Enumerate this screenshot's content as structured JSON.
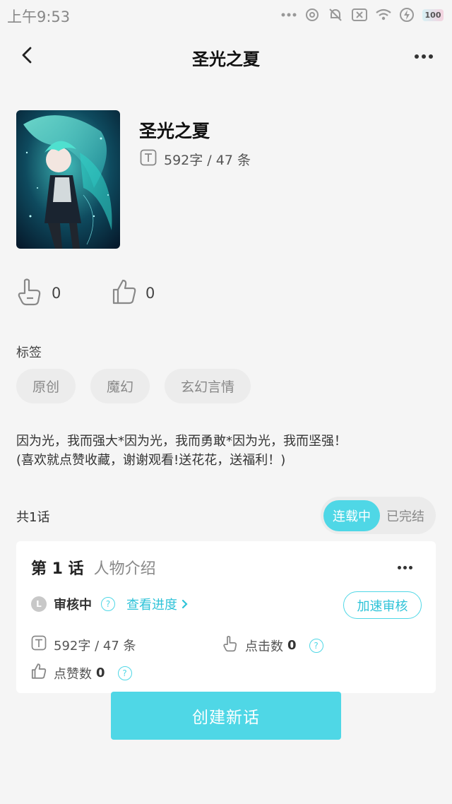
{
  "status_bar": {
    "time": "上午9:53",
    "battery": "100",
    "icons": [
      "dots-icon",
      "alarm-icon",
      "mute-icon",
      "sim-icon",
      "wifi-icon",
      "charging-icon",
      "battery-icon"
    ]
  },
  "navbar": {
    "title": "圣光之夏",
    "back_icon": "chevron-left-icon",
    "more_icon": "more-icon"
  },
  "book": {
    "title": "圣光之夏",
    "meta": "592字 / 47 条",
    "cover_icon": "anime-cover-image"
  },
  "reactions": [
    {
      "icon": "click-hand-icon",
      "count": "0"
    },
    {
      "icon": "thumbs-up-icon",
      "count": "0"
    }
  ],
  "tags": {
    "label": "标签",
    "items": [
      "原创",
      "魔幻",
      "玄幻言情"
    ]
  },
  "description": {
    "line1": "因为光，我而强大*因为光，我而勇敢*因为光，我而坚强！",
    "line2": "(喜欢就点赞收藏，谢谢观看!送花花，送福利！)"
  },
  "episodes": {
    "count_label": "共1话",
    "toggle": {
      "active": "连载中",
      "inactive": "已完结"
    },
    "items": [
      {
        "number": "第 1 话",
        "name": "人物介绍",
        "review_badge": "L",
        "review_status": "审核中",
        "progress_link": "查看进度",
        "speedup": "加速审核",
        "words": "592字 / 47 条",
        "clicks_label": "点击数",
        "clicks": "0",
        "likes_label": "点赞数",
        "likes": "0"
      }
    ]
  },
  "create_button": "创建新话",
  "colors": {
    "accent": "#4fd7e6",
    "accent_text": "#2fc3d8",
    "background": "#f5f5f5",
    "tag_bg": "#ececec"
  }
}
